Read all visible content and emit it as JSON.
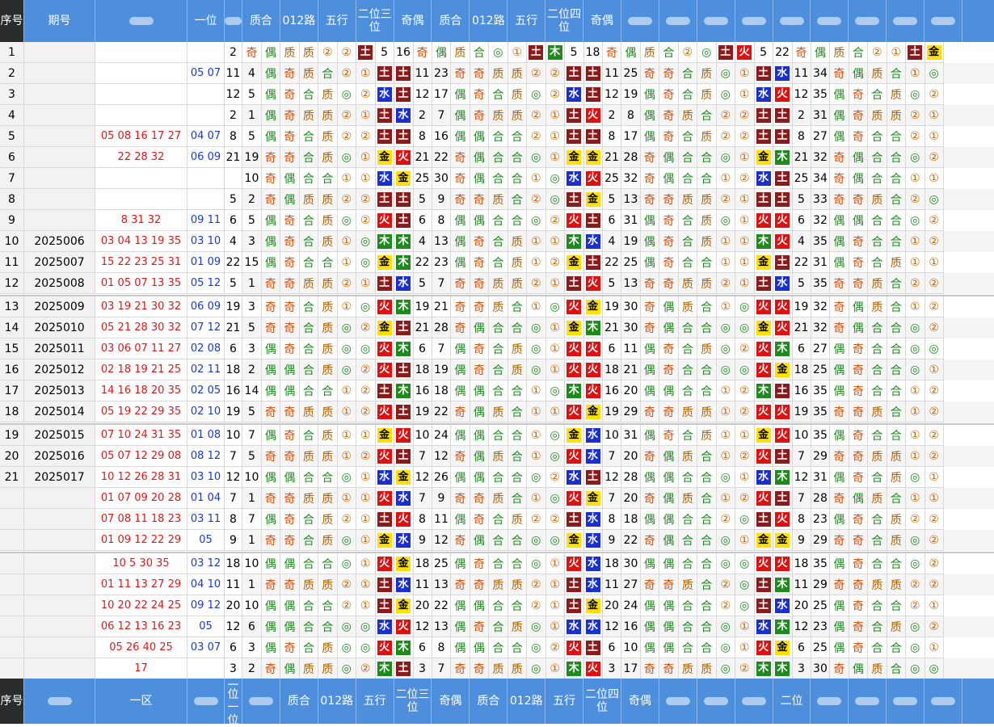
{
  "header": {
    "cells": [
      "序号",
      "期号",
      "",
      "一位",
      "",
      "质合",
      "012路",
      "五行",
      "二位三位",
      "奇偶",
      "质合",
      "012路",
      "五行",
      "二位四位",
      "奇偶",
      "",
      "",
      "",
      "",
      "",
      "",
      "",
      "",
      ""
    ],
    "footer_cells": [
      "序号",
      "",
      "一区",
      "",
      "二位一位",
      "",
      "质合",
      "012路",
      "五行",
      "二位三位",
      "奇偶",
      "质合",
      "012路",
      "五行",
      "二位四位",
      "奇偶",
      "",
      "",
      "",
      "二位",
      "",
      "",
      "",
      ""
    ]
  },
  "rows": [
    [
      "1",
      "",
      "",
      "",
      "2",
      "奇",
      "偶",
      "质",
      "质",
      "②",
      "②",
      "土",
      "5",
      "16",
      "奇",
      "偶",
      "质",
      "合",
      "◎",
      "①",
      "土",
      "木",
      "5",
      "18",
      "奇",
      "偶",
      "质",
      "合",
      "②",
      "◎",
      "土",
      "火",
      "5",
      "22",
      "奇",
      "偶",
      "质",
      "合",
      "②",
      "①",
      "土",
      "金"
    ],
    [
      "2",
      "",
      "",
      "05 07",
      "11",
      "4",
      "偶",
      "奇",
      "质",
      "合",
      "②",
      "①",
      "土",
      "土",
      "11",
      "23",
      "奇",
      "奇",
      "质",
      "质",
      "②",
      "②",
      "土",
      "土",
      "11",
      "25",
      "奇",
      "奇",
      "合",
      "质",
      "◎",
      "①",
      "土",
      "水",
      "11",
      "34",
      "奇",
      "偶",
      "质",
      "合",
      "①",
      "◎",
      "土",
      "土"
    ],
    [
      "3",
      "",
      "",
      "",
      "12",
      "5",
      "偶",
      "奇",
      "合",
      "质",
      "◎",
      "②",
      "水",
      "土",
      "12",
      "17",
      "偶",
      "奇",
      "合",
      "质",
      "◎",
      "②",
      "水",
      "土",
      "12",
      "19",
      "偶",
      "奇",
      "合",
      "质",
      "◎",
      "①",
      "水",
      "火",
      "12",
      "35",
      "偶",
      "奇",
      "合",
      "质",
      "◎",
      "②",
      "水",
      "土"
    ],
    [
      "4",
      "",
      "",
      "",
      "2",
      "1",
      "偶",
      "奇",
      "质",
      "质",
      "②",
      "①",
      "土",
      "水",
      "2",
      "7",
      "偶",
      "奇",
      "质",
      "质",
      "②",
      "①",
      "土",
      "火",
      "2",
      "8",
      "偶",
      "奇",
      "质",
      "合",
      "②",
      "②",
      "土",
      "土",
      "2",
      "31",
      "偶",
      "奇",
      "质",
      "质",
      "②",
      "①",
      "土",
      "土"
    ],
    [
      "5",
      "",
      "05 08 16 17 27",
      "04 07",
      "8",
      "5",
      "偶",
      "奇",
      "合",
      "质",
      "②",
      "②",
      "土",
      "土",
      "8",
      "16",
      "偶",
      "偶",
      "合",
      "合",
      "②",
      "①",
      "土",
      "土",
      "8",
      "17",
      "偶",
      "奇",
      "合",
      "质",
      "②",
      "②",
      "土",
      "土",
      "8",
      "27",
      "偶",
      "奇",
      "合",
      "合",
      "②",
      "①",
      "土",
      "土"
    ],
    [
      "6",
      "",
      "22 28 32",
      "06 09",
      "21",
      "19",
      "奇",
      "奇",
      "合",
      "质",
      "◎",
      "①",
      "金",
      "火",
      "21",
      "22",
      "奇",
      "偶",
      "合",
      "合",
      "◎",
      "①",
      "金",
      "金",
      "21",
      "28",
      "奇",
      "偶",
      "合",
      "合",
      "◎",
      "①",
      "金",
      "木",
      "21",
      "32",
      "奇",
      "偶",
      "合",
      "合",
      "◎",
      "②",
      "金",
      "土"
    ],
    [
      "7",
      "",
      "",
      "",
      "",
      "10",
      "奇",
      "偶",
      "合",
      "合",
      "①",
      "①",
      "水",
      "金",
      "25",
      "30",
      "奇",
      "偶",
      "合",
      "合",
      "①",
      "◎",
      "水",
      "火",
      "25",
      "32",
      "奇",
      "偶",
      "合",
      "合",
      "①",
      "②",
      "水",
      "土",
      "25",
      "34",
      "奇",
      "偶",
      "合",
      "合",
      "①",
      "①",
      "水",
      "水"
    ],
    [
      "8",
      "",
      "",
      "",
      "5",
      "2",
      "奇",
      "偶",
      "质",
      "质",
      "②",
      "②",
      "土",
      "土",
      "5",
      "9",
      "奇",
      "奇",
      "质",
      "合",
      "②",
      "◎",
      "土",
      "金",
      "5",
      "13",
      "奇",
      "奇",
      "质",
      "质",
      "②",
      "①",
      "土",
      "土",
      "5",
      "33",
      "奇",
      "奇",
      "质",
      "合",
      "②",
      "◎",
      "土",
      "金"
    ],
    [
      "9",
      "",
      "8 31 32",
      "09 11",
      "6",
      "5",
      "偶",
      "奇",
      "合",
      "质",
      "◎",
      "②",
      "火",
      "土",
      "6",
      "8",
      "偶",
      "偶",
      "合",
      "合",
      "◎",
      "②",
      "火",
      "土",
      "6",
      "31",
      "偶",
      "奇",
      "合",
      "质",
      "◎",
      "①",
      "火",
      "火",
      "6",
      "32",
      "偶",
      "偶",
      "合",
      "合",
      "◎",
      "②",
      "火",
      "土"
    ],
    [
      "10",
      "2025006",
      "03 04 13 19 35",
      "03 10",
      "4",
      "3",
      "偶",
      "奇",
      "合",
      "质",
      "①",
      "◎",
      "木",
      "木",
      "4",
      "13",
      "偶",
      "奇",
      "合",
      "质",
      "①",
      "①",
      "木",
      "水",
      "4",
      "19",
      "偶",
      "奇",
      "合",
      "质",
      "①",
      "①",
      "木",
      "火",
      "4",
      "35",
      "偶",
      "奇",
      "合",
      "合",
      "①",
      "②",
      "木",
      "土"
    ],
    [
      "11",
      "2025007",
      "15 22 23 25 31",
      "01 09",
      "22",
      "15",
      "偶",
      "奇",
      "合",
      "合",
      "①",
      "◎",
      "金",
      "木",
      "22",
      "23",
      "偶",
      "奇",
      "合",
      "质",
      "①",
      "②",
      "金",
      "土",
      "22",
      "25",
      "偶",
      "奇",
      "合",
      "合",
      "①",
      "①",
      "金",
      "土",
      "22",
      "31",
      "偶",
      "奇",
      "合",
      "质",
      "①",
      "①",
      "金",
      "火"
    ],
    [
      "12",
      "2025008",
      "01 05 07 13 35",
      "05 12",
      "5",
      "1",
      "奇",
      "奇",
      "质",
      "质",
      "②",
      "①",
      "土",
      "水",
      "5",
      "7",
      "奇",
      "奇",
      "质",
      "质",
      "②",
      "①",
      "土",
      "火",
      "5",
      "13",
      "奇",
      "奇",
      "质",
      "质",
      "②",
      "①",
      "土",
      "水",
      "5",
      "35",
      "奇",
      "奇",
      "质",
      "合",
      "②",
      "②",
      "土",
      "土"
    ],
    [
      "13",
      "2025009",
      "03 19 21 30 32",
      "06 09",
      "19",
      "3",
      "奇",
      "奇",
      "合",
      "质",
      "①",
      "◎",
      "火",
      "木",
      "19",
      "21",
      "奇",
      "奇",
      "质",
      "合",
      "①",
      "◎",
      "火",
      "金",
      "19",
      "30",
      "奇",
      "偶",
      "质",
      "合",
      "①",
      "◎",
      "火",
      "火",
      "19",
      "32",
      "奇",
      "偶",
      "质",
      "合",
      "①",
      "②",
      "火",
      "土"
    ],
    [
      "14",
      "2025010",
      "05 21 28 30 32",
      "07 12",
      "21",
      "5",
      "奇",
      "奇",
      "合",
      "质",
      "◎",
      "②",
      "金",
      "土",
      "21",
      "28",
      "奇",
      "偶",
      "合",
      "合",
      "◎",
      "①",
      "金",
      "木",
      "21",
      "30",
      "奇",
      "偶",
      "合",
      "合",
      "◎",
      "◎",
      "金",
      "火",
      "21",
      "32",
      "奇",
      "偶",
      "合",
      "合",
      "◎",
      "②",
      "金",
      "土"
    ],
    [
      "15",
      "2025011",
      "03 06 07 11 27",
      "02 08",
      "6",
      "3",
      "偶",
      "奇",
      "合",
      "质",
      "◎",
      "◎",
      "火",
      "木",
      "6",
      "7",
      "偶",
      "奇",
      "合",
      "质",
      "◎",
      "①",
      "火",
      "火",
      "6",
      "11",
      "偶",
      "奇",
      "合",
      "质",
      "◎",
      "②",
      "火",
      "木",
      "6",
      "27",
      "偶",
      "奇",
      "合",
      "合",
      "◎",
      "◎",
      "火",
      "土"
    ],
    [
      "16",
      "2025012",
      "02 18 19 21 25",
      "02 11",
      "18",
      "2",
      "偶",
      "偶",
      "合",
      "质",
      "◎",
      "②",
      "火",
      "土",
      "18",
      "19",
      "偶",
      "奇",
      "合",
      "质",
      "◎",
      "①",
      "火",
      "火",
      "18",
      "21",
      "偶",
      "奇",
      "合",
      "合",
      "◎",
      "◎",
      "火",
      "金",
      "18",
      "25",
      "偶",
      "奇",
      "合",
      "合",
      "◎",
      "①",
      "火",
      "土"
    ],
    [
      "17",
      "2025013",
      "14 16 18 20 35",
      "02 05",
      "16",
      "14",
      "偶",
      "偶",
      "合",
      "合",
      "①",
      "②",
      "土",
      "木",
      "16",
      "18",
      "偶",
      "偶",
      "合",
      "合",
      "①",
      "◎",
      "木",
      "火",
      "16",
      "20",
      "偶",
      "偶",
      "合",
      "合",
      "①",
      "②",
      "木",
      "土",
      "16",
      "35",
      "偶",
      "奇",
      "合",
      "合",
      "①",
      "②",
      "木",
      "土"
    ],
    [
      "18",
      "2025014",
      "05 19 22 29 35",
      "02 10",
      "19",
      "5",
      "奇",
      "奇",
      "质",
      "质",
      "①",
      "②",
      "火",
      "土",
      "19",
      "22",
      "奇",
      "偶",
      "质",
      "合",
      "①",
      "①",
      "火",
      "金",
      "19",
      "29",
      "奇",
      "奇",
      "质",
      "质",
      "①",
      "②",
      "火",
      "火",
      "19",
      "35",
      "奇",
      "奇",
      "质",
      "合",
      "①",
      "②",
      "火",
      "土"
    ],
    [
      "19",
      "2025015",
      "07 10 24 31 35",
      "01 08",
      "10",
      "7",
      "偶",
      "奇",
      "合",
      "质",
      "①",
      "①",
      "金",
      "火",
      "10",
      "24",
      "偶",
      "偶",
      "合",
      "合",
      "①",
      "◎",
      "金",
      "水",
      "10",
      "31",
      "偶",
      "奇",
      "合",
      "质",
      "①",
      "①",
      "金",
      "火",
      "10",
      "35",
      "偶",
      "奇",
      "合",
      "合",
      "①",
      "②",
      "金",
      "土"
    ],
    [
      "20",
      "2025016",
      "05 07 12 29 08",
      "08 12",
      "7",
      "5",
      "奇",
      "奇",
      "质",
      "质",
      "①",
      "②",
      "火",
      "土",
      "7",
      "12",
      "奇",
      "偶",
      "质",
      "合",
      "①",
      "◎",
      "火",
      "水",
      "7",
      "20",
      "奇",
      "偶",
      "质",
      "合",
      "①",
      "②",
      "火",
      "土",
      "7",
      "29",
      "奇",
      "奇",
      "质",
      "质",
      "①",
      "②",
      "火",
      "火"
    ],
    [
      "21",
      "2025017",
      "10 12 26 28 31",
      "03 10",
      "12",
      "10",
      "偶",
      "偶",
      "合",
      "合",
      "◎",
      "①",
      "水",
      "金",
      "12",
      "26",
      "偶",
      "偶",
      "合",
      "合",
      "◎",
      "②",
      "水",
      "土",
      "12",
      "28",
      "偶",
      "偶",
      "合",
      "合",
      "◎",
      "①",
      "水",
      "木",
      "12",
      "31",
      "偶",
      "奇",
      "合",
      "质",
      "◎",
      "①",
      "水",
      "水"
    ],
    [
      "",
      "",
      "01 07 09 20 28",
      "01 04",
      "7",
      "1",
      "奇",
      "奇",
      "质",
      "质",
      "①",
      "①",
      "火",
      "水",
      "7",
      "9",
      "奇",
      "奇",
      "质",
      "合",
      "①",
      "◎",
      "火",
      "金",
      "7",
      "20",
      "奇",
      "偶",
      "质",
      "合",
      "①",
      "②",
      "火",
      "土",
      "7",
      "28",
      "奇",
      "偶",
      "质",
      "合",
      "①",
      "①",
      "火",
      "火"
    ],
    [
      "",
      "",
      "07 08 11 18 23",
      "03 11",
      "8",
      "7",
      "偶",
      "奇",
      "合",
      "质",
      "②",
      "①",
      "土",
      "火",
      "8",
      "11",
      "偶",
      "奇",
      "合",
      "质",
      "②",
      "②",
      "土",
      "水",
      "8",
      "18",
      "偶",
      "偶",
      "合",
      "合",
      "②",
      "◎",
      "土",
      "火",
      "8",
      "23",
      "偶",
      "奇",
      "合",
      "质",
      "②",
      "②",
      "土",
      "土"
    ],
    [
      "",
      "",
      "01 09 12 22 29",
      "05",
      "9",
      "1",
      "奇",
      "奇",
      "合",
      "质",
      "◎",
      "①",
      "金",
      "水",
      "9",
      "12",
      "奇",
      "偶",
      "合",
      "合",
      "◎",
      "◎",
      "金",
      "水",
      "9",
      "22",
      "奇",
      "偶",
      "合",
      "合",
      "◎",
      "①",
      "金",
      "金",
      "9",
      "29",
      "奇",
      "奇",
      "合",
      "质",
      "◎",
      "②",
      "金",
      "金"
    ],
    [
      "",
      "",
      "10 5 30 35",
      "03 12",
      "18",
      "10",
      "偶",
      "偶",
      "合",
      "合",
      "◎",
      "①",
      "火",
      "金",
      "18",
      "25",
      "偶",
      "奇",
      "合",
      "合",
      "◎",
      "①",
      "火",
      "水",
      "18",
      "30",
      "偶",
      "偶",
      "合",
      "合",
      "◎",
      "◎",
      "火",
      "火",
      "18",
      "35",
      "偶",
      "奇",
      "合",
      "合",
      "◎",
      "②",
      "火",
      "木"
    ],
    [
      "",
      "",
      "01 11 13 27 29",
      "04 10",
      "11",
      "1",
      "奇",
      "奇",
      "质",
      "质",
      "②",
      "①",
      "土",
      "水",
      "11",
      "13",
      "奇",
      "奇",
      "质",
      "质",
      "②",
      "①",
      "土",
      "水",
      "11",
      "27",
      "奇",
      "奇",
      "质",
      "合",
      "②",
      "◎",
      "土",
      "木",
      "11",
      "29",
      "奇",
      "奇",
      "质",
      "质",
      "②",
      "②",
      "土",
      "土"
    ],
    [
      "",
      "",
      "10 20 22 24 25",
      "09 12",
      "20",
      "10",
      "偶",
      "偶",
      "合",
      "合",
      "②",
      "①",
      "土",
      "金",
      "20",
      "22",
      "偶",
      "偶",
      "合",
      "合",
      "②",
      "①",
      "土",
      "金",
      "20",
      "24",
      "偶",
      "偶",
      "合",
      "合",
      "②",
      "◎",
      "土",
      "水",
      "20",
      "25",
      "偶",
      "奇",
      "合",
      "合",
      "②",
      "①",
      "土",
      "土"
    ],
    [
      "",
      "",
      "06 12 13 16 23",
      "05",
      "12",
      "6",
      "偶",
      "偶",
      "合",
      "合",
      "◎",
      "◎",
      "水",
      "火",
      "12",
      "13",
      "偶",
      "奇",
      "合",
      "质",
      "◎",
      "①",
      "水",
      "水",
      "12",
      "16",
      "偶",
      "偶",
      "合",
      "合",
      "◎",
      "①",
      "水",
      "木",
      "12",
      "23",
      "偶",
      "奇",
      "合",
      "质",
      "◎",
      "②",
      "水",
      "水"
    ],
    [
      "",
      "",
      "05 26 40 25",
      "03 07",
      "6",
      "3",
      "偶",
      "奇",
      "合",
      "质",
      "◎",
      "◎",
      "火",
      "木",
      "6",
      "8",
      "偶",
      "偶",
      "合",
      "合",
      "◎",
      "②",
      "火",
      "土",
      "6",
      "10",
      "偶",
      "偶",
      "合",
      "合",
      "◎",
      "①",
      "火",
      "金",
      "6",
      "25",
      "偶",
      "奇",
      "合",
      "合",
      "◎",
      "①",
      "火",
      "土"
    ],
    [
      "",
      "",
      "17",
      "",
      "3",
      "2",
      "奇",
      "偶",
      "质",
      "质",
      "◎",
      "②",
      "木",
      "土",
      "3",
      "7",
      "奇",
      "奇",
      "质",
      "质",
      "◎",
      "①",
      "木",
      "火",
      "3",
      "17",
      "奇",
      "奇",
      "质",
      "质",
      "◎",
      "②",
      "木",
      "木",
      "3",
      "30",
      "奇",
      "偶",
      "质",
      "合",
      "◎",
      "◎",
      "木",
      "土"
    ]
  ],
  "colors": {
    "header_bg": "#4d8fdc",
    "odd": "#d94c00",
    "even": "#1e8a1e",
    "prime": "#b06000",
    "composite": "#1e8a1e",
    "circle": "#c86400",
    "circle2": "#1e8a1e",
    "earth": "#8b1a1a",
    "water": "#1a2fd0",
    "fire": "#e01010",
    "wood": "#1e8a1e",
    "metal": "#ffe000",
    "draw_red": "#e01818",
    "draw_blue": "#1a3ac8"
  }
}
